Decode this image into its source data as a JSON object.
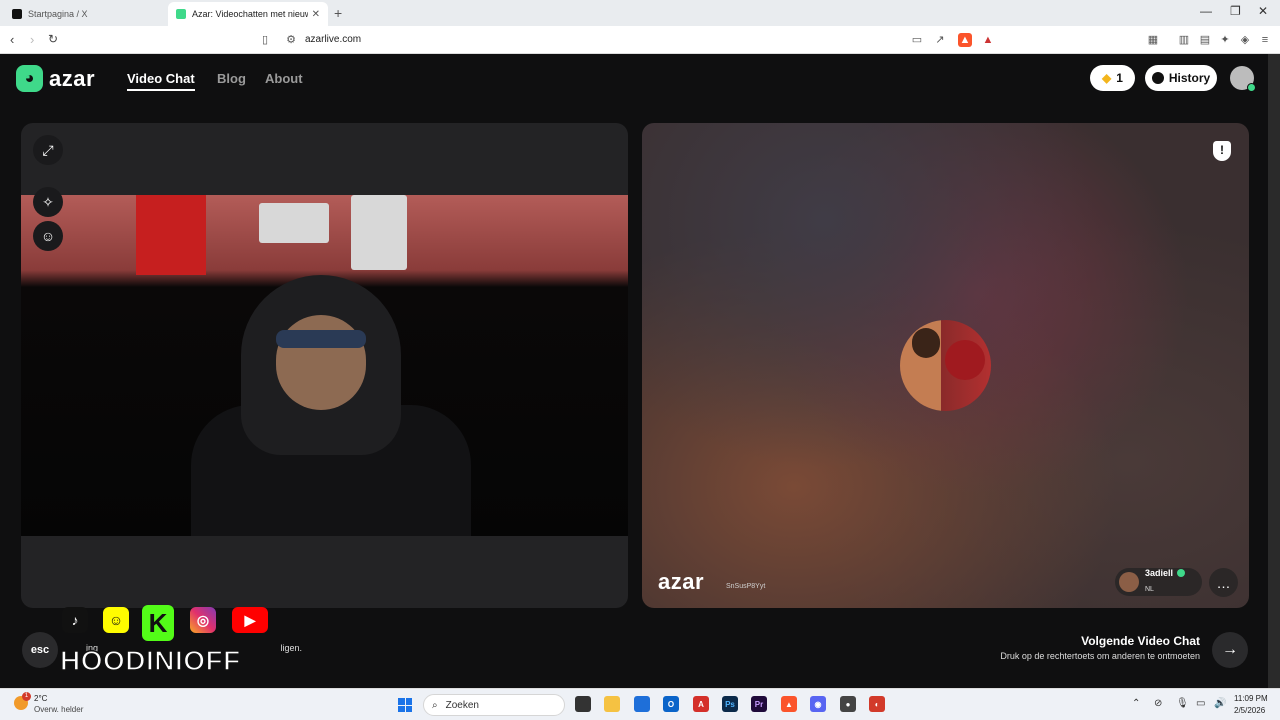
{
  "browser": {
    "tabs": [
      {
        "title": "Startpagina / X",
        "favicon": "x-icon",
        "active": false
      },
      {
        "title": "Azar: Videochatten met nieuw",
        "favicon": "azar-icon",
        "active": true
      }
    ],
    "url": "azarlive.com"
  },
  "app": {
    "logo_text": "azar",
    "nav": [
      {
        "label": "Video Chat",
        "active": true
      },
      {
        "label": "Blog",
        "active": false
      },
      {
        "label": "About",
        "active": false
      }
    ],
    "gems": "1",
    "history_label": "History",
    "colors": {
      "accent": "#3fd98a",
      "background": "#0f0f10",
      "gem": "#f3b51c"
    }
  },
  "left_panel": {
    "side_buttons": [
      "expand-icon",
      "magic-wand-icon",
      "sticker-icon"
    ],
    "esc_label": "esc",
    "esc_text_partial": "ligen."
  },
  "right_panel": {
    "watermark": "azar",
    "watermark_id": "SnSusP8Yyt",
    "user": {
      "name": "3adiell",
      "country": "NL"
    }
  },
  "overlay": {
    "brand": "HOODINIOFF",
    "socials": [
      "tiktok-icon",
      "snapchat-icon",
      "kick-icon",
      "instagram-icon",
      "youtube-icon"
    ],
    "partial_text": "ing"
  },
  "next": {
    "title": "Volgende Video Chat",
    "subtitle": "Druk op de rechtertoets om anderen te ontmoeten"
  },
  "taskbar": {
    "temperature": "2°C",
    "weather": "Overw. helder",
    "weather_badge": "1",
    "search_placeholder": "Zoeken",
    "time": "11:09 PM",
    "date": "2/5/2026"
  }
}
